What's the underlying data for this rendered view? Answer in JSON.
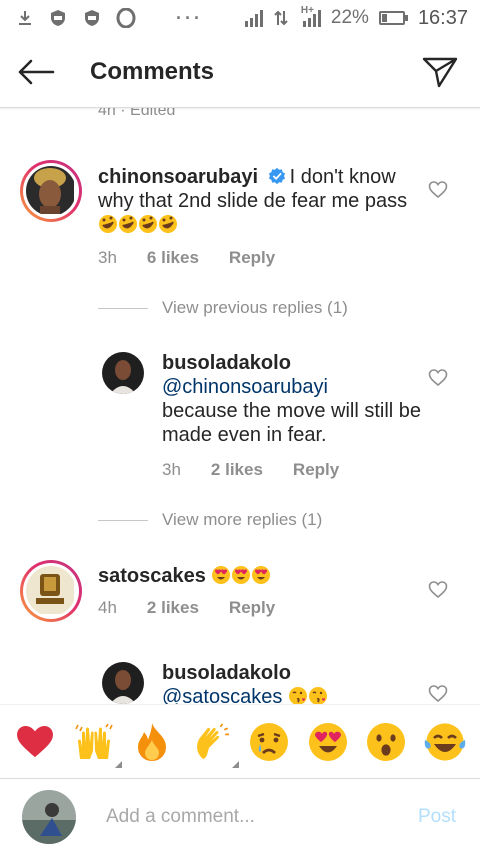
{
  "status_bar": {
    "battery_percent": "22%",
    "time": "16:37",
    "network_label": "H+",
    "battery_level": 0.22
  },
  "header": {
    "title": "Comments"
  },
  "top_comment_tail": {
    "meta": "4h · Edited"
  },
  "comments": [
    {
      "username": "chinonsoarubayi",
      "verified": true,
      "text": "I don't know why that 2nd slide de fear me pass",
      "emojis": [
        "rofl",
        "rofl",
        "rofl",
        "rofl"
      ],
      "time": "3h",
      "likes": "6 likes",
      "reply": "Reply"
    },
    {
      "username": "satoscakes",
      "text": "",
      "emojis": [
        "heart-eyes",
        "heart-eyes",
        "heart-eyes"
      ],
      "time": "4h",
      "likes": "2 likes",
      "reply": "Reply"
    }
  ],
  "replies": [
    {
      "username": "busoladakolo",
      "mention": "@chinonsoarubayi",
      "text": "because the move will still be made even in fear.",
      "time": "3h",
      "likes": "2 likes",
      "reply": "Reply"
    },
    {
      "username": "busoladakolo",
      "mention": "@satoscakes",
      "emojis": [
        "kiss",
        "kiss"
      ]
    }
  ],
  "view_previous_replies": "View previous replies (1)",
  "view_more_replies": "View more replies (1)",
  "emoji_bar": [
    "red-heart",
    "raising-hands",
    "fire",
    "clapping-hands",
    "crying-face",
    "heart-eyes",
    "surprised-face",
    "tears-of-joy"
  ],
  "composer": {
    "placeholder": "Add a comment...",
    "post_label": "Post"
  },
  "colors": {
    "mention": "#003569",
    "post_disabled": "#b2dffc",
    "story_ring": "#e1306c"
  }
}
